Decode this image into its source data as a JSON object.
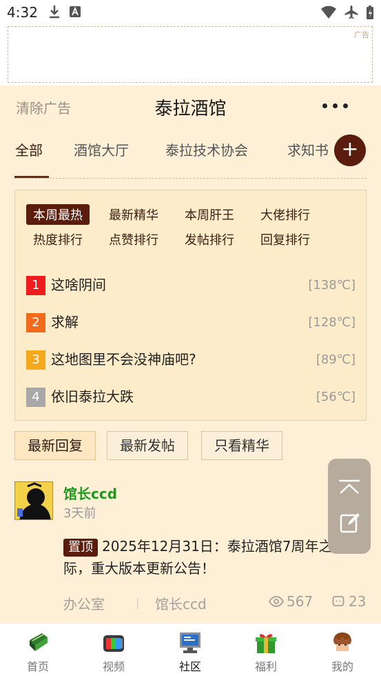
{
  "status_bar": {
    "time": "4:32"
  },
  "ad": {
    "tag": "广告"
  },
  "header": {
    "clear_ad": "清除广告",
    "title": "泰拉酒馆"
  },
  "tabs": [
    {
      "label": "全部"
    },
    {
      "label": "酒馆大厅"
    },
    {
      "label": "泰拉技术协会"
    },
    {
      "label": "求知书"
    }
  ],
  "ranking": {
    "chips_row1": [
      "本周最热",
      "最新精华",
      "本周肝王",
      "大佬排行"
    ],
    "chips_row2": [
      "热度排行",
      "点赞排行",
      "发帖排行",
      "回复排行"
    ],
    "items": [
      {
        "num": "1",
        "title": "这啥阴间",
        "temp": "[138℃]",
        "color": "#ee1c1c"
      },
      {
        "num": "2",
        "title": "求解",
        "temp": "[128℃]",
        "color": "#f26b1d"
      },
      {
        "num": "3",
        "title": "这地图里不会没神庙吧?",
        "temp": "[89℃]",
        "color": "#f6a91c"
      },
      {
        "num": "4",
        "title": "依旧泰拉大跌",
        "temp": "[56℃]",
        "color": "#a8a8a8"
      }
    ]
  },
  "filters": [
    {
      "label": "最新回复"
    },
    {
      "label": "最新发帖"
    },
    {
      "label": "只看精华"
    }
  ],
  "post": {
    "author": "馆长ccd",
    "time": "3天前",
    "pin": "置顶",
    "text": "2025年12月31日：泰拉酒馆7周年之际，重大版本更新公告！",
    "board": "办公室",
    "separator": "|",
    "board_author": "馆长ccd",
    "views": "567",
    "comments": "23"
  },
  "bottom_nav": [
    {
      "label": "首页"
    },
    {
      "label": "视频"
    },
    {
      "label": "社区"
    },
    {
      "label": "福利"
    },
    {
      "label": "我的"
    }
  ],
  "colors": {
    "accent": "#5a1c0c",
    "background": "#fdf0d7",
    "author": "#1c9a1c"
  }
}
